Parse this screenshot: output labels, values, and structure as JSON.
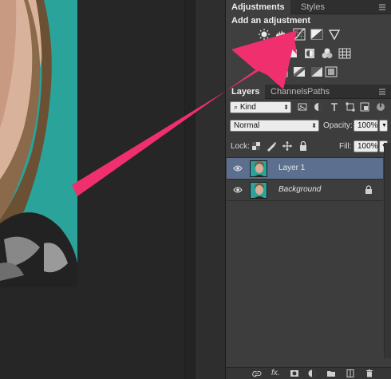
{
  "adjustments_panel": {
    "tabs": [
      {
        "label": "Adjustments",
        "active": true
      },
      {
        "label": "Styles",
        "active": false
      }
    ],
    "heading": "Add an adjustment",
    "row1_icons": [
      "brightness-contrast-icon",
      "levels-icon",
      "curves-icon",
      "exposure-icon",
      "vibrance-icon"
    ],
    "row2_icons": [
      "hue-saturation-icon",
      "color-balance-icon",
      "black-white-icon",
      "photo-filter-icon",
      "channel-mixer-icon",
      "color-lookup-icon"
    ],
    "row3_icons": [
      "invert-icon",
      "posterize-icon",
      "threshold-icon",
      "gradient-map-icon",
      "selective-color-icon"
    ]
  },
  "layers_panel": {
    "tabs": [
      {
        "label": "Layers",
        "active": true
      },
      {
        "label": "Channels",
        "active": false
      },
      {
        "label": "Paths",
        "active": false
      }
    ],
    "filter": {
      "value": "Kind"
    },
    "blend_mode": {
      "value": "Normal"
    },
    "opacity": {
      "label": "Opacity:",
      "value": "100%"
    },
    "lock": {
      "label": "Lock:"
    },
    "fill": {
      "label": "Fill:",
      "value": "100%"
    },
    "layers": [
      {
        "name": "Layer 1",
        "selected": true,
        "visible": true,
        "locked": false
      },
      {
        "name": "Background",
        "selected": false,
        "visible": true,
        "locked": true
      }
    ],
    "footer": {
      "fx_label": "fx."
    }
  },
  "colors": {
    "annotation_arrow": "#f0306e",
    "selected_layer": "#5c6f8e",
    "canvas_background": "#2aa39a",
    "panel_background": "#3f3f3f"
  }
}
